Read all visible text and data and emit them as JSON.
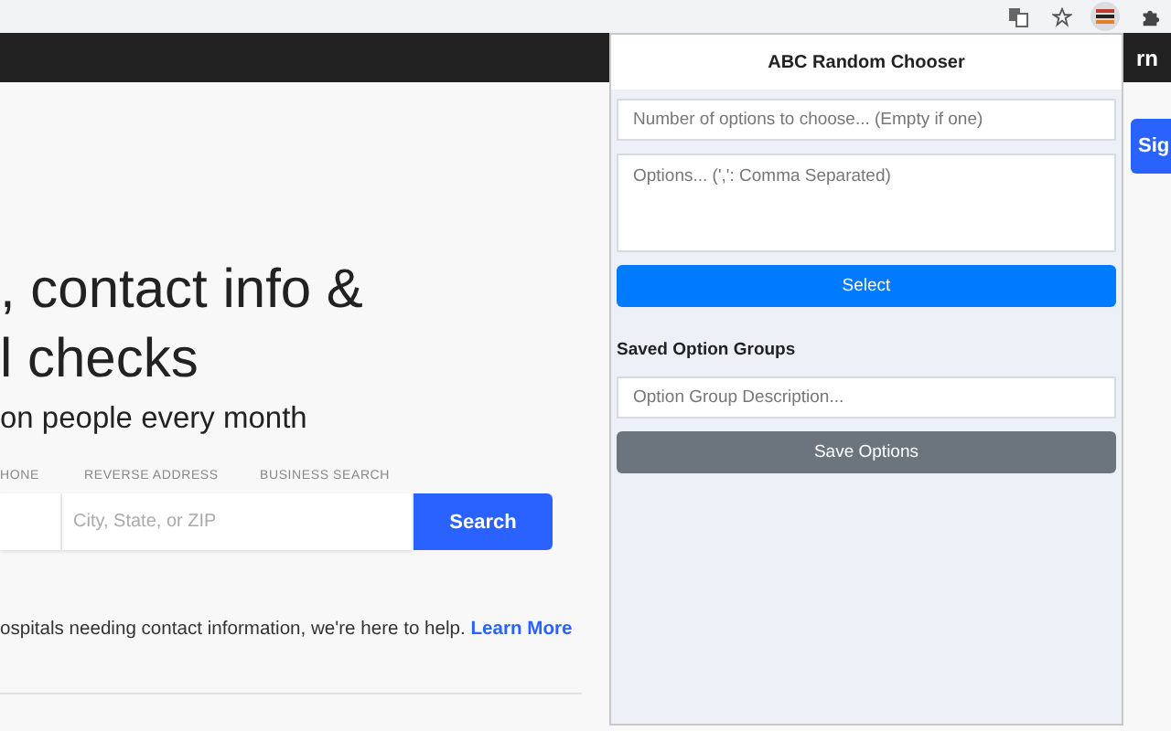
{
  "page": {
    "header_link": "rn",
    "headline": [
      ", contact info &",
      "l checks"
    ],
    "subtitle": "on people every month",
    "search_tabs": [
      "HONE",
      "REVERSE ADDRESS",
      "BUSINESS SEARCH"
    ],
    "location_placeholder": "City, State, or ZIP",
    "search_button": "Search",
    "blurb": "ospitals needing contact information, we're here to help.",
    "learn_more": "Learn More",
    "sign_button": "Sig"
  },
  "popup": {
    "title": "ABC Random Chooser",
    "count_placeholder": "Number of options to choose... (Empty if one)",
    "options_placeholder": "Options... (',': Comma Separated)",
    "select_button": "Select",
    "section_title": "Saved Option Groups",
    "group_placeholder": "Option Group Description...",
    "save_button": "Save Options"
  }
}
